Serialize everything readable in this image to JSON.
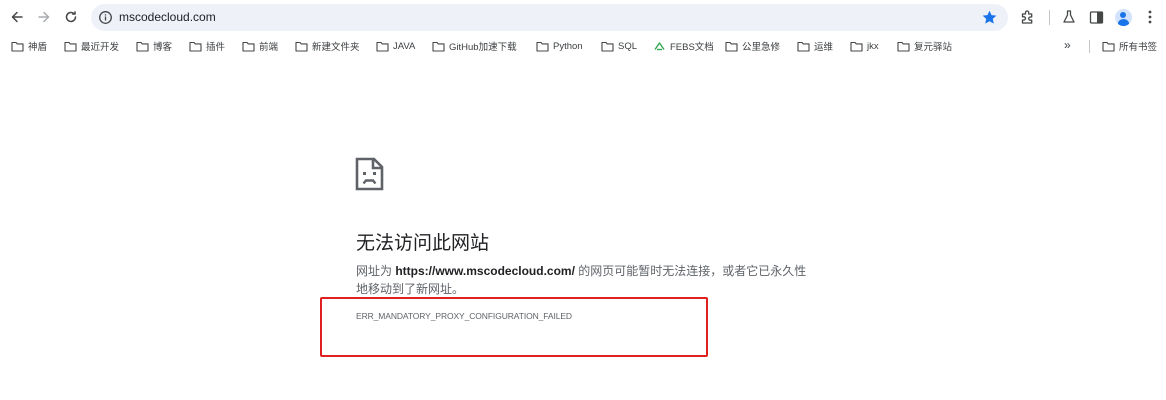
{
  "toolbar": {
    "url": "mscodecloud.com",
    "icons": {
      "back": "arrow-left-icon",
      "forward": "arrow-right-icon",
      "reload": "reload-icon",
      "site_info": "info-icon",
      "bookmark_star": "star-icon",
      "extensions": "puzzle-icon",
      "labs": "flask-icon",
      "side_panel": "side-panel-icon",
      "profile": "avatar-icon",
      "menu": "kebab-menu-icon"
    },
    "accent_color": "#1a73e8"
  },
  "bookmarks": {
    "items": [
      {
        "label": "神盾",
        "icon": "folder-icon"
      },
      {
        "label": "最近开发",
        "icon": "folder-icon"
      },
      {
        "label": "博客",
        "icon": "folder-icon"
      },
      {
        "label": "插件",
        "icon": "folder-icon"
      },
      {
        "label": "前端",
        "icon": "folder-icon"
      },
      {
        "label": "新建文件夹",
        "icon": "folder-icon"
      },
      {
        "label": "JAVA",
        "icon": "folder-icon"
      },
      {
        "label": "GitHub加速下载",
        "icon": "folder-icon"
      },
      {
        "label": "Python",
        "icon": "folder-icon"
      },
      {
        "label": "SQL",
        "icon": "folder-icon"
      },
      {
        "label": "FEBS文档",
        "icon": "febs-logo-icon"
      },
      {
        "label": "公里急修",
        "icon": "folder-icon"
      },
      {
        "label": "运维",
        "icon": "folder-icon"
      },
      {
        "label": "jkx",
        "icon": "folder-icon"
      },
      {
        "label": "复元驿站",
        "icon": "folder-icon"
      }
    ],
    "more": "»",
    "all_bookmarks": "所有书签"
  },
  "error": {
    "icon": "sad-page-icon",
    "title": "无法访问此网站",
    "desc_prefix": "网址为 ",
    "desc_url": "https://www.mscodecloud.com/",
    "desc_suffix": " 的网页可能暂时无法连接，或者它已永久性地移动到了新网址。",
    "code": "ERR_MANDATORY_PROXY_CONFIGURATION_FAILED",
    "highlight_color": "#e02020"
  }
}
